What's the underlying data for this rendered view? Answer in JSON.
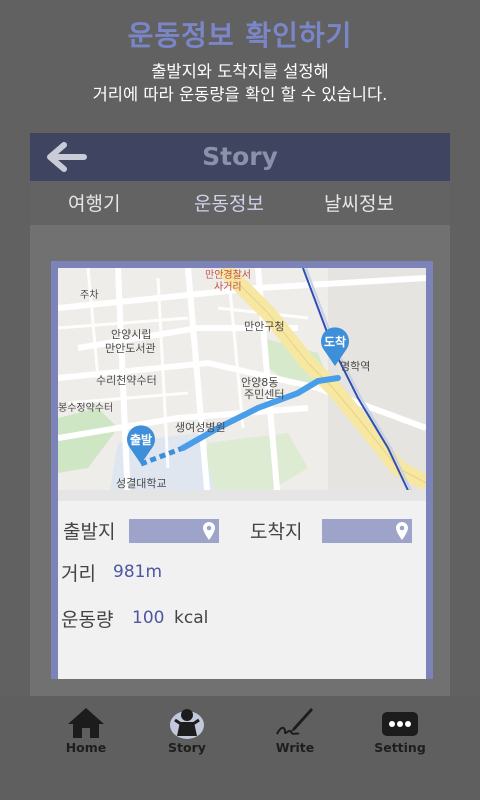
{
  "intro": {
    "title": "운동정보 확인하기",
    "line1": "출발지와 도착지를 설정해",
    "line2": "거리에 따라 운동량을 확인 할 수 있습니다."
  },
  "appbar": {
    "title": "Story"
  },
  "tabs": [
    "여행기",
    "운동정보",
    "날씨정보"
  ],
  "map": {
    "start_marker": "출발",
    "end_marker": "도착",
    "labels": [
      "만안경찰서",
      "사거리",
      "주차",
      "안양시립",
      "만안도서관",
      "만안구청",
      "수리천약수터",
      "안양8동",
      "주민센터",
      "명학역",
      "생여성병원",
      "봉수정약수터",
      "성결대학교"
    ]
  },
  "route": {
    "start_label": "출발지",
    "end_label": "도착지",
    "distance_label": "거리",
    "distance_value": "981m",
    "exercise_label": "운동량",
    "exercise_value": "100",
    "exercise_unit": "kcal"
  },
  "nav": [
    {
      "label": "Home",
      "icon": "home-icon"
    },
    {
      "label": "Story",
      "icon": "story-icon"
    },
    {
      "label": "Write",
      "icon": "write-icon"
    },
    {
      "label": "Setting",
      "icon": "setting-icon"
    }
  ],
  "colors": {
    "accent": "#7a86c8",
    "appbar": "#3f4560",
    "marker": "#3d8fd9",
    "box": "#9ea3c9"
  }
}
